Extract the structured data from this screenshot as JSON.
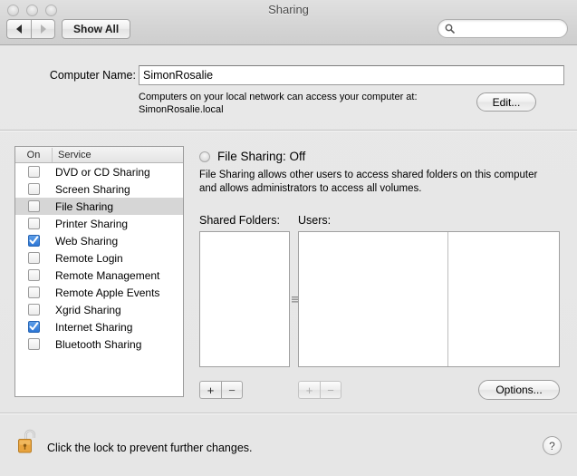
{
  "window": {
    "title": "Sharing",
    "traffic_lights": [
      "close",
      "minimize",
      "zoom"
    ]
  },
  "toolbar": {
    "back_icon": "back-arrow-icon",
    "forward_icon": "forward-arrow-icon",
    "show_all_label": "Show All",
    "search": {
      "value": "",
      "placeholder": "",
      "icon": "search-icon"
    }
  },
  "computer_name": {
    "label": "Computer Name:",
    "value": "SimonRosalie",
    "help_line1": "Computers on your local network can access your computer at:",
    "help_line2": "SimonRosalie.local",
    "edit_label": "Edit..."
  },
  "services": {
    "headers": {
      "on": "On",
      "service": "Service"
    },
    "rows": [
      {
        "name": "DVD or CD Sharing",
        "checked": false,
        "selected": false
      },
      {
        "name": "Screen Sharing",
        "checked": false,
        "selected": false
      },
      {
        "name": "File Sharing",
        "checked": false,
        "selected": true
      },
      {
        "name": "Printer Sharing",
        "checked": false,
        "selected": false
      },
      {
        "name": "Web Sharing",
        "checked": true,
        "selected": false
      },
      {
        "name": "Remote Login",
        "checked": false,
        "selected": false
      },
      {
        "name": "Remote Management",
        "checked": false,
        "selected": false
      },
      {
        "name": "Remote Apple Events",
        "checked": false,
        "selected": false
      },
      {
        "name": "Xgrid Sharing",
        "checked": false,
        "selected": false
      },
      {
        "name": "Internet Sharing",
        "checked": true,
        "selected": false
      },
      {
        "name": "Bluetooth Sharing",
        "checked": false,
        "selected": false
      }
    ]
  },
  "detail": {
    "status_title": "File Sharing: Off",
    "status_state": "off",
    "description": "File Sharing allows other users to access shared folders on this computer and allows administrators to access all volumes.",
    "shared_folders_label": "Shared Folders:",
    "users_label": "Users:",
    "shared_folders_items": [],
    "users_items": [],
    "add_label": "+",
    "remove_label": "−",
    "options_label": "Options...",
    "resize_grip_icon": "resize-grip-icon"
  },
  "footer": {
    "lock_icon": "unlocked-padlock-icon",
    "lock_text": "Click the lock to prevent further changes.",
    "help_label": "?"
  },
  "colors": {
    "checkbox_on": "#2d76d6",
    "row_selected": "#d6d6d6",
    "window_bg": "#ececec",
    "lock_gold": "#e8a33d"
  }
}
